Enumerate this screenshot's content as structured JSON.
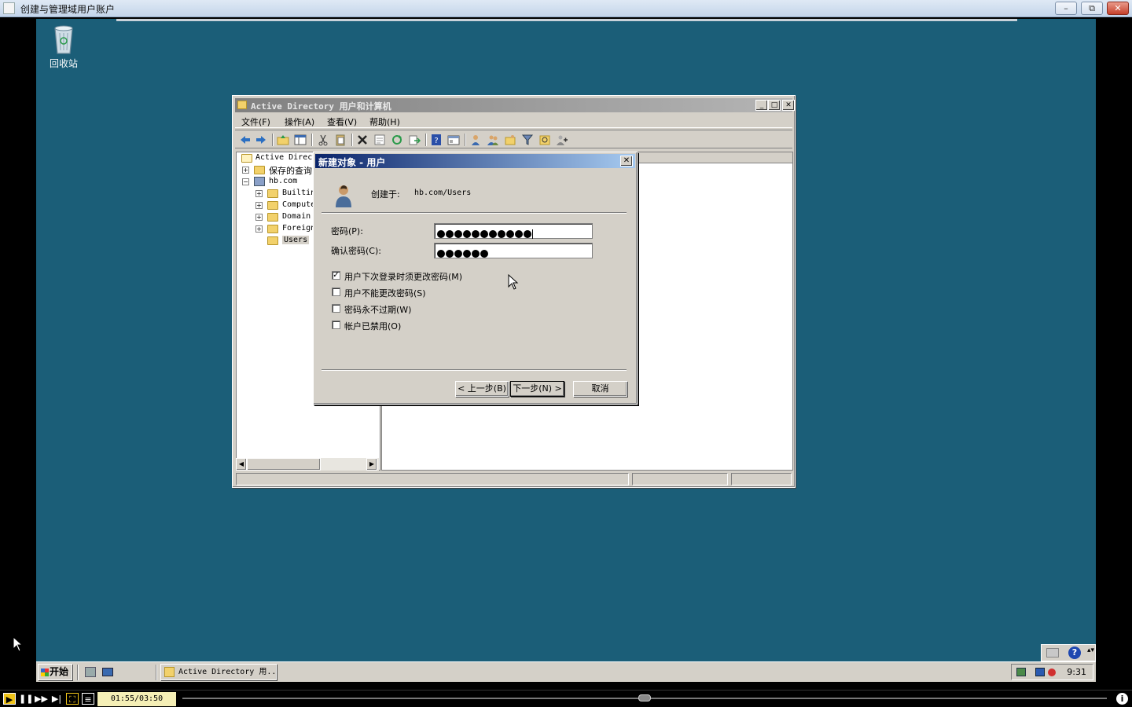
{
  "player": {
    "title": "创建与管理域用户账户",
    "minimize": "–",
    "restore": "⧉",
    "close": "✕",
    "time": "01:55/03:50",
    "info": "i",
    "progress_fraction": 0.5
  },
  "desktop": {
    "recycle_bin_label": "回收站",
    "background_color": "#1b5e78"
  },
  "aduc": {
    "title": "Active Directory 用户和计算机",
    "menus": [
      "文件(F)",
      "操作(A)",
      "查看(V)",
      "帮助(H)"
    ],
    "tree": {
      "root": "Active Directo",
      "saved_queries": "保存的查询",
      "domain": "hb.com",
      "children": [
        "Builtin",
        "Compute",
        "Domain",
        "Foreign",
        "Users"
      ]
    }
  },
  "dialog": {
    "title": "新建对象 - 用户",
    "close": "✕",
    "created_in_label": "创建于:",
    "created_in_value": "hb.com/Users",
    "password_label": "密码(P):",
    "password_dots": 11,
    "confirm_label": "确认密码(C):",
    "confirm_dots": 6,
    "checkboxes": [
      {
        "label": "用户下次登录时须更改密码(M)",
        "checked": true
      },
      {
        "label": "用户不能更改密码(S)",
        "checked": false
      },
      {
        "label": "密码永不过期(W)",
        "checked": false
      },
      {
        "label": "帐户已禁用(O)",
        "checked": false
      }
    ],
    "back_button": "< 上一步(B)",
    "next_button": "下一步(N) >",
    "cancel_button": "取消"
  },
  "taskbar": {
    "start_label": "开始",
    "task_aduc": "Active Directory 用...",
    "clock": "9:31",
    "help": "?"
  },
  "colors": {
    "dialog_title_start": "#0a246a",
    "dialog_title_end": "#a6caf0",
    "classic_gray": "#d4d0c8"
  }
}
